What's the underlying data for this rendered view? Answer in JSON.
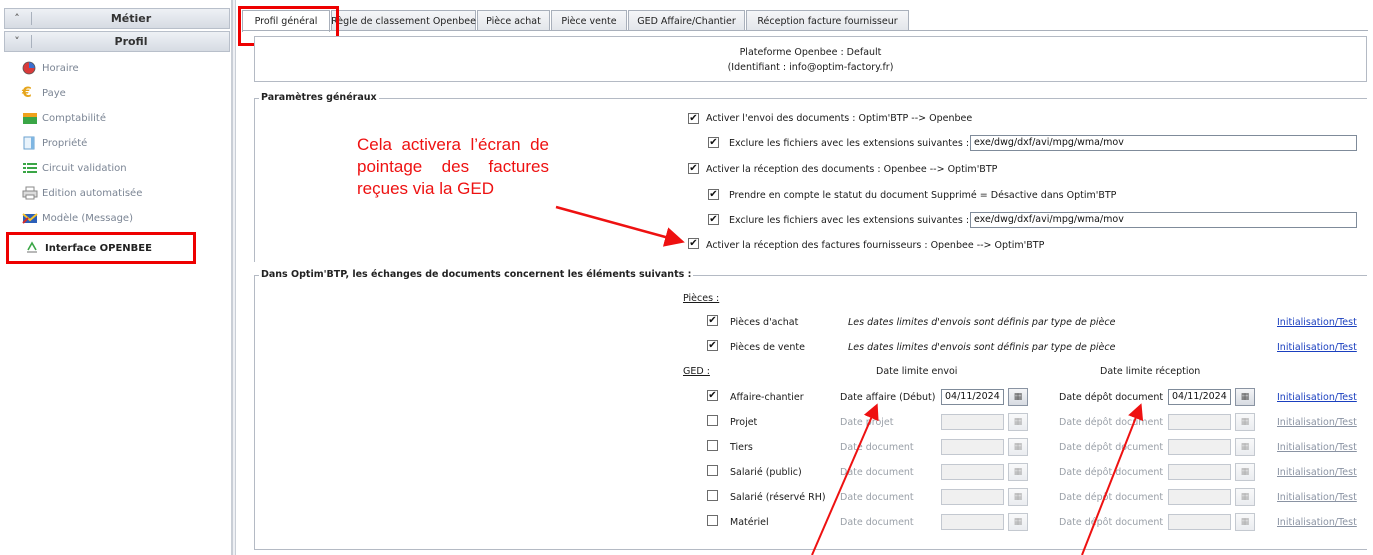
{
  "sidebar": {
    "sections": [
      {
        "label": "Métier",
        "icon": "chevrons-up-icon"
      },
      {
        "label": "Profil",
        "icon": "chevrons-down-icon"
      }
    ],
    "items": [
      {
        "label": "Horaire",
        "icon": "clock-icon"
      },
      {
        "label": "Paye",
        "icon": "euro-icon"
      },
      {
        "label": "Comptabilité",
        "icon": "folder-icon"
      },
      {
        "label": "Propriété",
        "icon": "document-icon"
      },
      {
        "label": "Circuit validation",
        "icon": "list-icon"
      },
      {
        "label": "Edition automatisée",
        "icon": "printer-icon"
      },
      {
        "label": "Modèle (Message)",
        "icon": "mail-icon"
      },
      {
        "label": "Interface OPENBEE",
        "icon": "openbee-icon",
        "active": true
      }
    ]
  },
  "tabs": [
    {
      "label": "Profil général",
      "active": true
    },
    {
      "label": "Règle de classement Openbee"
    },
    {
      "label": "Pièce achat"
    },
    {
      "label": "Pièce vente"
    },
    {
      "label": "GED Affaire/Chantier"
    },
    {
      "label": "Réception facture fournisseur"
    }
  ],
  "platform": {
    "line1": "Plateforme Openbee : Default",
    "line2": "(Identifiant : info@optim-factory.fr)"
  },
  "params": {
    "legend": "Paramètres généraux",
    "send": {
      "checked": true,
      "label": "Activer l'envoi des documents : Optim'BTP --> Openbee"
    },
    "send_exclude": {
      "checked": true,
      "label": "Exclure les fichiers avec les extensions suivantes :",
      "value": "exe/dwg/dxf/avi/mpg/wma/mov"
    },
    "receive": {
      "checked": true,
      "label": "Activer la réception des documents : Openbee --> Optim'BTP"
    },
    "deleted_status": {
      "checked": true,
      "label": "Prendre en compte le statut du document Supprimé = Désactive dans Optim'BTP"
    },
    "receive_exclude": {
      "checked": true,
      "label": "Exclure les fichiers avec les extensions suivantes :",
      "value": "exe/dwg/dxf/avi/mpg/wma/mov"
    },
    "invoices": {
      "checked": true,
      "label": "Activer la réception des factures fournisseurs : Openbee --> Optim'BTP"
    }
  },
  "exchanges": {
    "legend": "Dans Optim'BTP, les échanges de documents concernent les éléments suivants :",
    "pieces_heading": "Pièces :",
    "pieces": [
      {
        "checked": true,
        "label": "Pièces d'achat",
        "note": "Les dates limites d'envois sont définis par type de pièce",
        "link": "Initialisation/Test"
      },
      {
        "checked": true,
        "label": "Pièces de vente",
        "note": "Les dates limites d'envois sont définis par type de pièce",
        "link": "Initialisation/Test"
      }
    ],
    "ged_heading": "GED :",
    "col_send": "Date limite envoi",
    "col_receive": "Date limite réception",
    "ged": [
      {
        "checked": true,
        "label": "Affaire-chantier",
        "send_label": "Date affaire (Début)",
        "send_value": "04/11/2024",
        "recv_label": "Date dépôt document",
        "recv_value": "04/11/2024",
        "link": "Initialisation/Test",
        "enabled": true
      },
      {
        "checked": false,
        "label": "Projet",
        "send_label": "Date projet",
        "send_value": "",
        "recv_label": "Date dépôt document",
        "recv_value": "",
        "link": "Initialisation/Test",
        "enabled": false
      },
      {
        "checked": false,
        "label": "Tiers",
        "send_label": "Date document",
        "send_value": "",
        "recv_label": "Date dépôt document",
        "recv_value": "",
        "link": "Initialisation/Test",
        "enabled": false
      },
      {
        "checked": false,
        "label": "Salarié (public)",
        "send_label": "Date document",
        "send_value": "",
        "recv_label": "Date dépôt document",
        "recv_value": "",
        "link": "Initialisation/Test",
        "enabled": false
      },
      {
        "checked": false,
        "label": "Salarié (réservé RH)",
        "send_label": "Date document",
        "send_value": "",
        "recv_label": "Date dépôt document",
        "recv_value": "",
        "link": "Initialisation/Test",
        "enabled": false
      },
      {
        "checked": false,
        "label": "Matériel",
        "send_label": "Date document",
        "send_value": "",
        "recv_label": "Date dépôt document",
        "recv_value": "",
        "link": "Initialisation/Test",
        "enabled": false
      }
    ]
  },
  "annotation": {
    "text": "Cela activera l’écran de pointage des factures reçues via la GED",
    "color": "#ee1111"
  },
  "colors": {
    "highlight": "#ee0000",
    "link": "#1a3fbf"
  }
}
